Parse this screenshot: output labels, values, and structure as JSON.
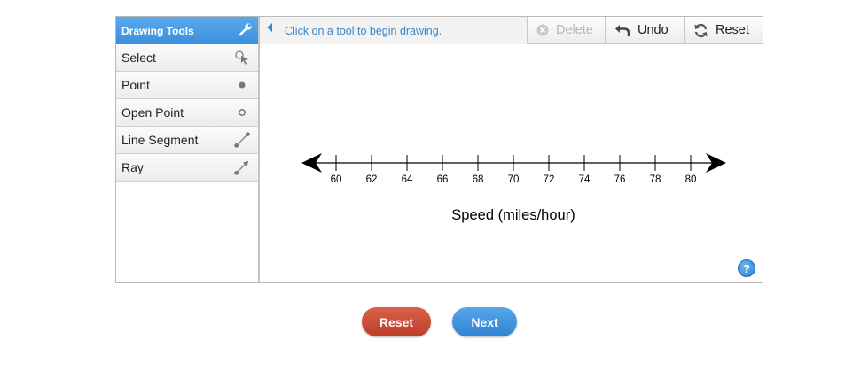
{
  "toolbar": {
    "title": "Drawing Tools",
    "prompt": "Click on a tool to begin drawing.",
    "delete_label": "Delete",
    "undo_label": "Undo",
    "reset_label": "Reset"
  },
  "tools": [
    {
      "label": "Select",
      "icon": "select-cursor-icon"
    },
    {
      "label": "Point",
      "icon": "closed-point-icon"
    },
    {
      "label": "Open Point",
      "icon": "open-point-icon"
    },
    {
      "label": "Line Segment",
      "icon": "line-segment-icon"
    },
    {
      "label": "Ray",
      "icon": "ray-icon"
    }
  ],
  "number_line": {
    "ticks": [
      "60",
      "62",
      "64",
      "66",
      "68",
      "70",
      "72",
      "74",
      "76",
      "78",
      "80"
    ],
    "label": "Speed (miles/hour)"
  },
  "help": {
    "label": "?"
  },
  "footer": {
    "reset_label": "Reset",
    "next_label": "Next"
  },
  "colors": {
    "accent": "#3a8fdd",
    "reset_button": "#c9482f",
    "next_button": "#3b8fdc"
  }
}
